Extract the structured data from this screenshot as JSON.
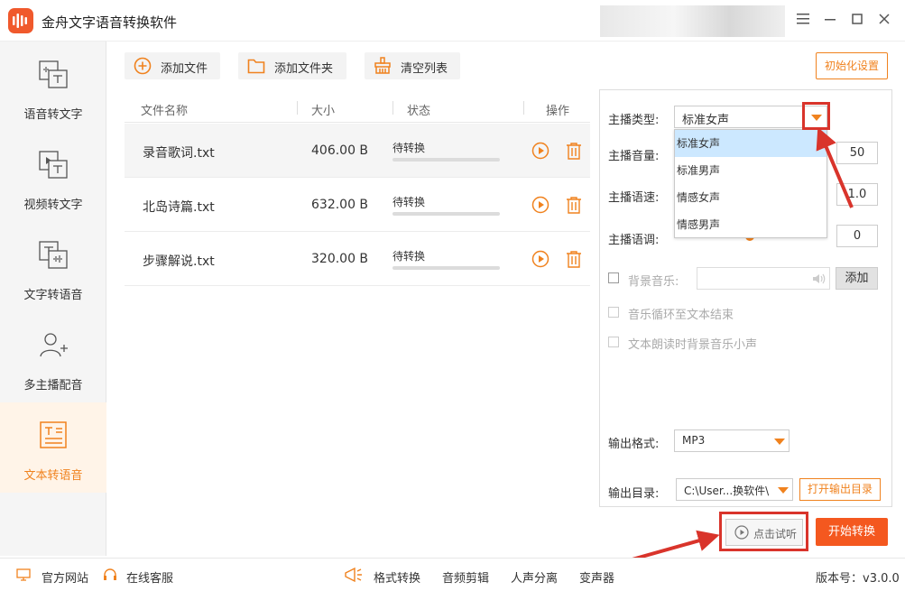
{
  "app": {
    "title": "金舟文字语音转换软件"
  },
  "sidebar": {
    "items": [
      {
        "label": "语音转文字",
        "icon": "speech-to-text-icon"
      },
      {
        "label": "视频转文字",
        "icon": "video-to-text-icon"
      },
      {
        "label": "文字转语音",
        "icon": "text-to-speech-icon"
      },
      {
        "label": "多主播配音",
        "icon": "multi-voice-icon"
      },
      {
        "label": "文本转语音",
        "icon": "document-to-speech-icon",
        "active": true
      }
    ]
  },
  "toolbar": {
    "add_file": "添加文件",
    "add_folder": "添加文件夹",
    "clear_list": "清空列表",
    "init_settings": "初始化设置"
  },
  "table": {
    "columns": [
      "文件名称",
      "大小",
      "状态",
      "操作"
    ],
    "rows": [
      {
        "name": "录音歌词.txt",
        "size": "406.00 B",
        "status": "待转换",
        "progress": 0
      },
      {
        "name": "北岛诗篇.txt",
        "size": "632.00 B",
        "status": "待转换",
        "progress": 0
      },
      {
        "name": "步骤解说.txt",
        "size": "320.00 B",
        "status": "待转换",
        "progress": 0
      }
    ]
  },
  "settings": {
    "voice_type_label": "主播类型:",
    "voice_type_value": "标准女声",
    "voice_options": [
      "标准女声",
      "标准男声",
      "情感女声",
      "情感男声"
    ],
    "volume_label": "主播音量:",
    "volume_value": "50",
    "speed_label": "主播语速:",
    "speed_value": "1.0",
    "tone_label": "主播语调:",
    "tone_value": "0",
    "bgm_label": "背景音乐:",
    "bgm_add": "添加",
    "loop_label": "音乐循环至文本结束",
    "duck_label": "文本朗读时背景音乐小声",
    "format_label": "输出格式:",
    "format_value": "MP3",
    "dir_label": "输出目录:",
    "dir_value": "C:\\User...换软件\\",
    "open_dir": "打开输出目录"
  },
  "actions": {
    "listen": "点击试听",
    "start": "开始转换"
  },
  "footer": {
    "website": "官方网站",
    "support": "在线客服",
    "tools": [
      "格式转换",
      "音频剪辑",
      "人声分离",
      "变声器"
    ],
    "version": "版本号：v3.0.0"
  },
  "colors": {
    "accent": "#f0821e",
    "start": "#f4581f",
    "highlight": "#d9342b"
  }
}
